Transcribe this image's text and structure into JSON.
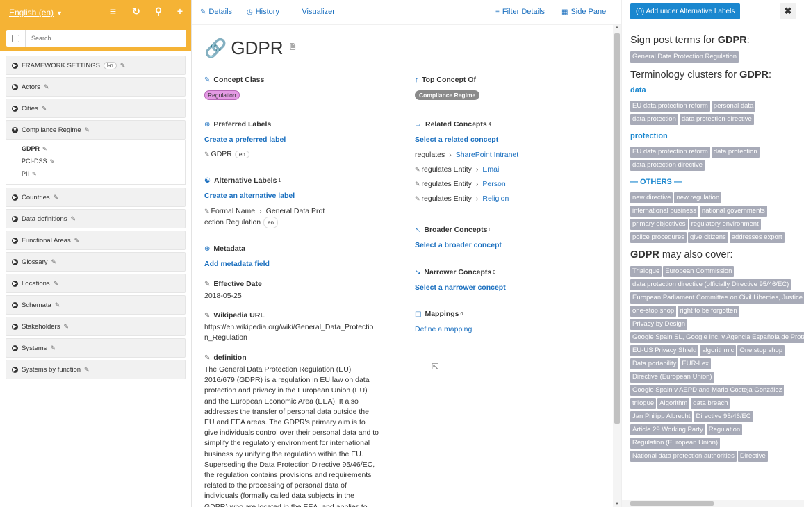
{
  "sidebar": {
    "language": "English (en)",
    "search_placeholder": "Search...",
    "tree": [
      {
        "label": "FRAMEWORK SETTINGS",
        "badge": "l-n"
      },
      {
        "label": "Actors"
      },
      {
        "label": "Cities"
      },
      {
        "label": "Compliance Regime",
        "expanded": true,
        "children": [
          {
            "label": "GDPR",
            "active": true
          },
          {
            "label": "PCI-DSS"
          },
          {
            "label": "PII"
          }
        ]
      },
      {
        "label": "Countries"
      },
      {
        "label": "Data definitions"
      },
      {
        "label": "Functional Areas"
      },
      {
        "label": "Glossary"
      },
      {
        "label": "Locations"
      },
      {
        "label": "Schemata"
      },
      {
        "label": "Stakeholders"
      },
      {
        "label": "Systems"
      },
      {
        "label": "Systems by function"
      }
    ]
  },
  "tabs": {
    "details": "Details",
    "history": "History",
    "visualizer": "Visualizer",
    "filter": "Filter Details",
    "side_panel": "Side Panel"
  },
  "concept": {
    "title": "GDPR",
    "concept_class": {
      "heading": "Concept Class",
      "value": "Regulation"
    },
    "preferred_labels": {
      "heading": "Preferred Labels",
      "action": "Create a preferred label",
      "label": "GDPR",
      "lang": "en"
    },
    "alt_labels": {
      "heading": "Alternative Labels",
      "count": "1",
      "action": "Create an alternative label",
      "type": "Formal Name",
      "value_line1": "General Data Prot",
      "value_line2": "ection Regulation",
      "lang": "en"
    },
    "metadata": {
      "heading": "Metadata",
      "action": "Add metadata field"
    },
    "effective_date": {
      "heading": "Effective Date",
      "value": "2018-05-25"
    },
    "wikipedia": {
      "heading": "Wikipedia URL",
      "line1": "https://en.wikipedia.org/wiki/General_Data_Protectio",
      "line2": "n_Regulation"
    },
    "definition": {
      "heading": "definition",
      "text": "The General Data Protection Regulation (EU) 2016/679 (GDPR) is a regulation in EU law on data protection and privacy in the European Union (EU) and the European Economic Area (EEA). It also addresses the transfer of personal data outside the EU and EEA areas. The GDPR's primary aim is to give individuals control over their personal data and to simplify the regulatory environment for international business by unifying the regulation within the EU. Superseding the Data Protection Directive 95/46/EC, the regulation contains provisions and requirements related to the processing of personal data of individuals (formally called data subjects in the GDPR) who are located in the EEA, and applies to any"
    },
    "top_concept": {
      "heading": "Top Concept Of",
      "value": "Compliance Regime"
    },
    "related": {
      "heading": "Related Concepts",
      "count": "4",
      "action": "Select a related concept",
      "items": [
        {
          "rel": "regulates",
          "target": "SharePoint Intranet",
          "editable": false
        },
        {
          "rel": "regulates Entity",
          "target": "Email",
          "editable": true
        },
        {
          "rel": "regulates Entity",
          "target": "Person",
          "editable": true
        },
        {
          "rel": "regulates Entity",
          "target": "Religion",
          "editable": true
        }
      ]
    },
    "broader": {
      "heading": "Broader Concepts",
      "count": "0",
      "action": "Select a broader concept"
    },
    "narrower": {
      "heading": "Narrower Concepts",
      "count": "0",
      "action": "Select a narrower concept"
    },
    "mappings": {
      "heading": "Mappings",
      "count": "0",
      "action": "Define a mapping"
    }
  },
  "right_panel": {
    "add_button": "(0) Add under Alternative Labels",
    "signpost_prefix": "Sign post terms for ",
    "signpost_suffix": ":",
    "term": "GDPR",
    "signpost_tags": [
      "General Data Protection Regulation"
    ],
    "clusters_prefix": "Terminology clusters for ",
    "clusters_suffix": ":",
    "clusters": [
      {
        "name": "data",
        "tags": [
          "EU data protection reform",
          "personal data",
          "data protection",
          "data protection directive"
        ]
      },
      {
        "name": "protection",
        "tags": [
          "EU data protection reform",
          "data protection",
          "data protection directive"
        ]
      },
      {
        "name": "— OTHERS —",
        "tags": [
          "new directive",
          "new regulation",
          "international business",
          "national governments",
          "primary objectives",
          "regulatory environment",
          "police procedures",
          "give citizens",
          "addresses export"
        ]
      }
    ],
    "also_cover_suffix": " may also cover:",
    "also_cover_tags": [
      "Trialogue",
      "European Commission",
      "data protection directive (officially Directive 95/46/EC)",
      "European Parliament Committee on Civil Liberties, Justice",
      "one-stop shop",
      "right to be forgotten",
      "Privacy by Design",
      "Google Spain SL, Google Inc. v Agencia Española de Protec",
      "EU-US Privacy Shield",
      "algorithmic",
      "One stop shop",
      "Data portability",
      "EUR-Lex",
      "Directive (European Union)",
      "Google Spain v AEPD and Mario Costeja González",
      "trilogue",
      "Algorithm",
      "data breach",
      "Jan Philipp Albrecht",
      "Directive 95/46/EC",
      "Article 29 Working Party",
      "Regulation",
      "Regulation (European Union)",
      "National data protection authorities",
      "Directive"
    ]
  }
}
